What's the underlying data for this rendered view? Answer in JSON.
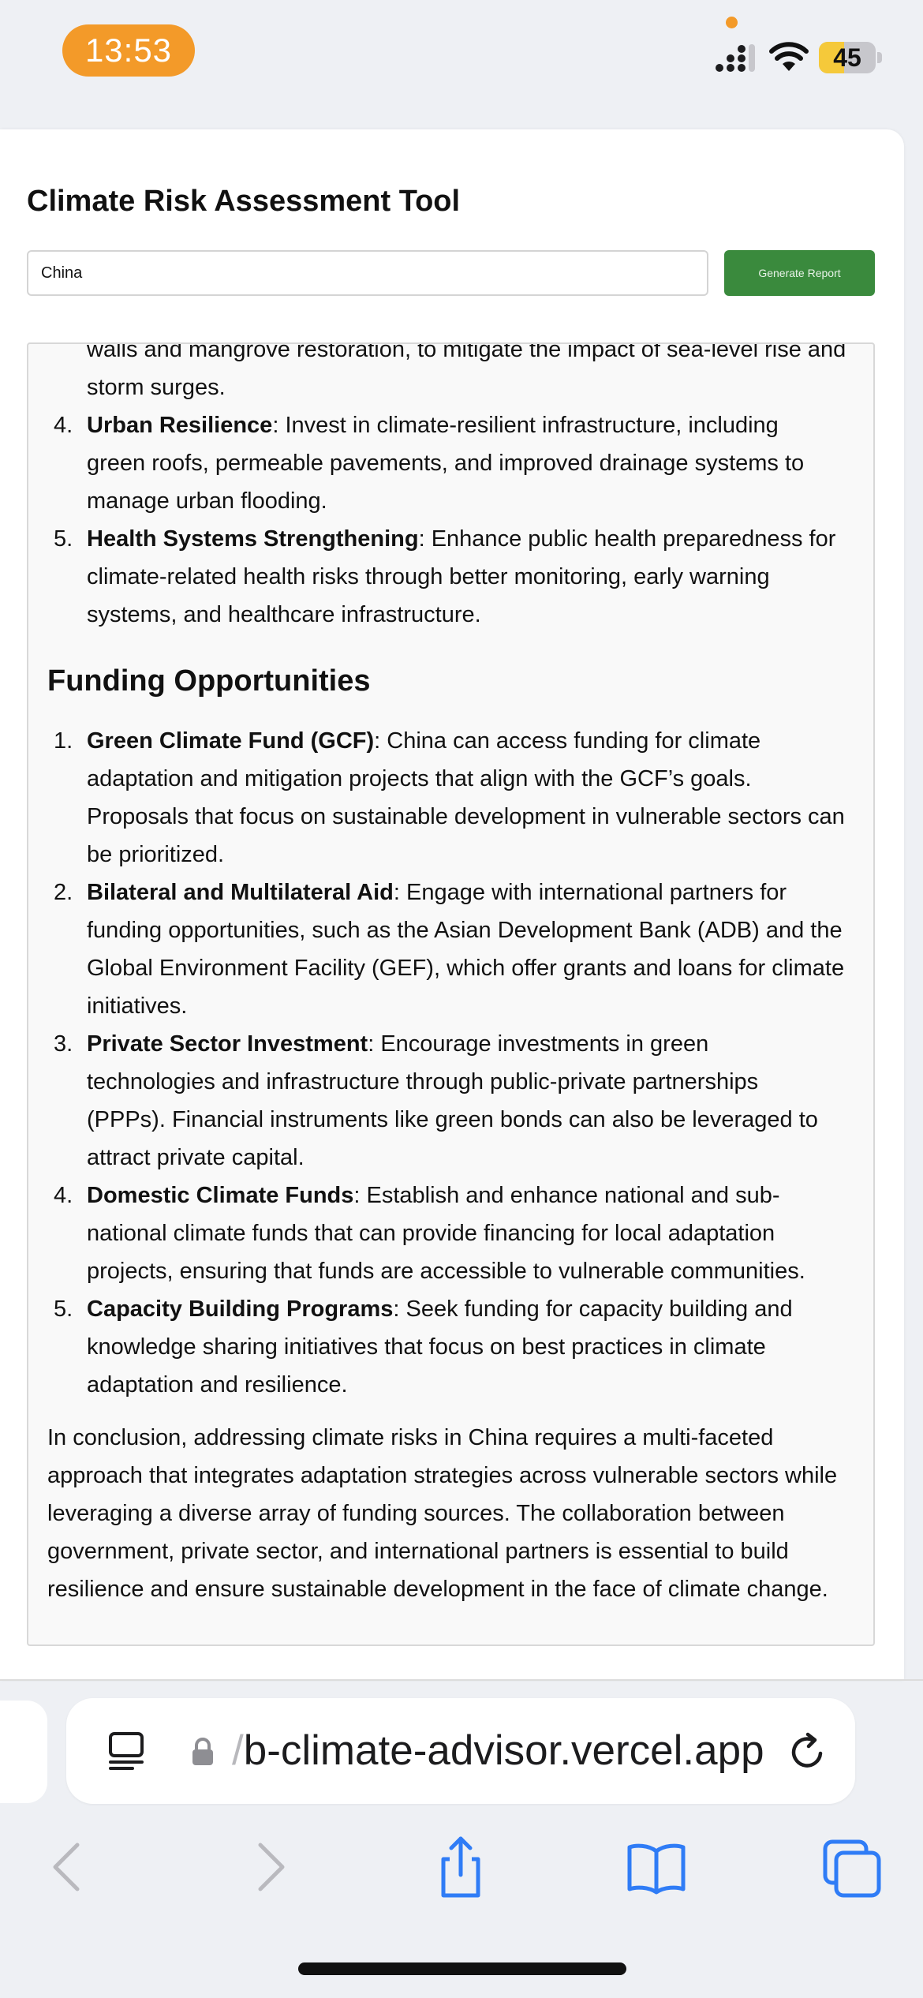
{
  "status_bar": {
    "time": "13:53",
    "battery_level": "45",
    "battery_fraction": 0.45,
    "accent_color": "#f39a29"
  },
  "app": {
    "title": "Climate Risk Assessment Tool",
    "country_value": "China",
    "generate_label": "Generate Report",
    "button_color": "#3a8a3d"
  },
  "report": {
    "adaptation_tail": {
      "continuation": [
        "walls and mangrove restoration, to mitigate the impact of sea-level rise and",
        "storm surges."
      ],
      "items": [
        {
          "number": "4.",
          "title": "Urban Resilience",
          "lines": [
            ": Invest in climate-resilient infrastructure, including",
            "green roofs, permeable pavements, and improved drainage systems to",
            "manage urban flooding."
          ]
        },
        {
          "number": "5.",
          "title": "Health Systems Strengthening",
          "lines": [
            ": Enhance public health preparedness for",
            "climate-related health risks through better monitoring, early warning",
            "systems, and healthcare infrastructure."
          ]
        }
      ]
    },
    "funding_heading": "Funding Opportunities",
    "funding_items": [
      {
        "number": "1.",
        "title": "Green Climate Fund (GCF)",
        "lines": [
          ": China can access funding for climate",
          "adaptation and mitigation projects that align with the GCF’s goals.",
          "Proposals that focus on sustainable development in vulnerable sectors can",
          "be prioritized."
        ]
      },
      {
        "number": "2.",
        "title": "Bilateral and Multilateral Aid",
        "lines": [
          ": Engage with international partners for",
          "funding opportunities, such as the Asian Development Bank (ADB) and the",
          "Global Environment Facility (GEF), which offer grants and loans for climate",
          "initiatives."
        ]
      },
      {
        "number": "3.",
        "title": "Private Sector Investment",
        "lines": [
          ": Encourage investments in green",
          "technologies and infrastructure through public-private partnerships",
          "(PPPs). Financial instruments like green bonds can also be leveraged to",
          "attract private capital."
        ]
      },
      {
        "number": "4.",
        "title": "Domestic Climate Funds",
        "lines": [
          ": Establish and enhance national and sub-",
          "national climate funds that can provide financing for local adaptation",
          "projects, ensuring that funds are accessible to vulnerable communities."
        ]
      },
      {
        "number": "5.",
        "title": "Capacity Building Programs",
        "lines": [
          ": Seek funding for capacity building and",
          "knowledge sharing initiatives that focus on best practices in climate",
          "adaptation and resilience."
        ]
      }
    ],
    "conclusion_lines": [
      "In conclusion, addressing climate risks in China requires a multi-faceted",
      "approach that integrates adaptation strategies across vulnerable sectors while",
      "leveraging a diverse array of funding sources. The collaboration between",
      "government, private sector, and international partners is essential to build",
      "resilience and ensure sustainable development in the face of climate change."
    ]
  },
  "browser": {
    "url_prefix": "/",
    "url_main": "b-climate-advisor.vercel.app",
    "icons": [
      "reader-icon",
      "lock-icon",
      "reload-icon",
      "back-icon",
      "forward-icon",
      "share-icon",
      "bookmarks-icon",
      "tabs-icon"
    ]
  }
}
